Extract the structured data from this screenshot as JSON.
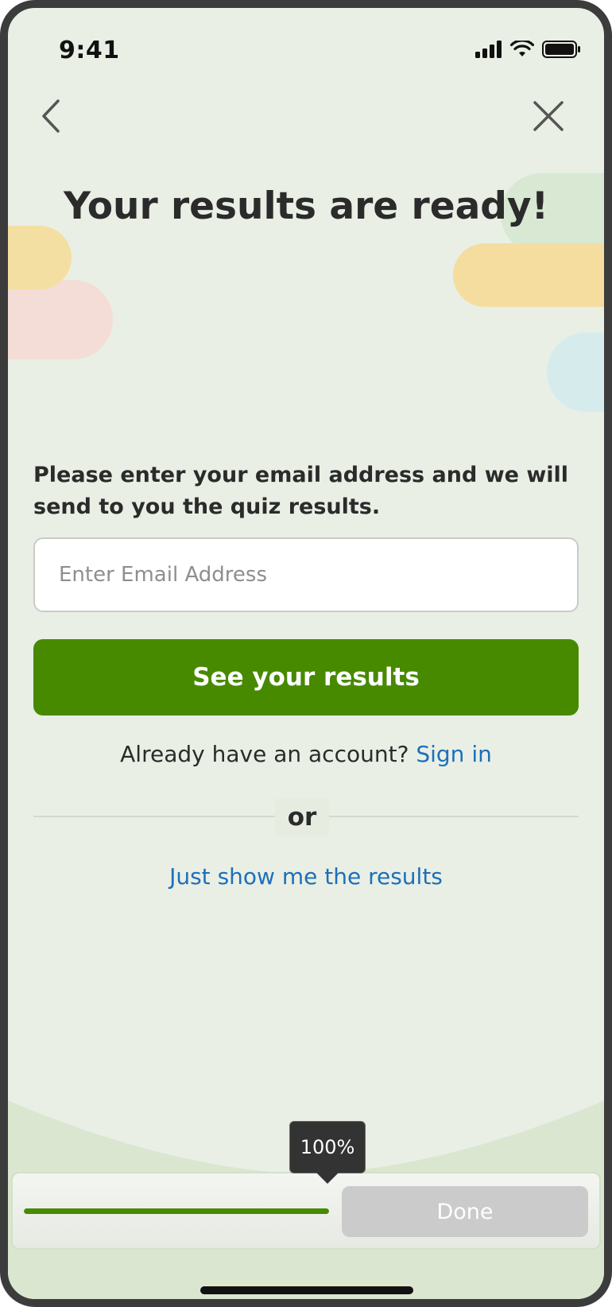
{
  "status_bar": {
    "time": "9:41",
    "icons": [
      "cellular-signal-icon",
      "wifi-icon",
      "battery-icon"
    ]
  },
  "nav": {
    "back_icon": "chevron-left-icon",
    "close_icon": "close-icon"
  },
  "header": {
    "title": "Your results are ready!"
  },
  "form": {
    "prompt": "Please enter your email address and we will send to you the quiz results.",
    "email_placeholder": "Enter Email Address",
    "email_value": "",
    "submit_label": "See your results"
  },
  "account": {
    "question": "Already have an account?",
    "sign_in_label": "Sign in"
  },
  "divider": {
    "label": "or"
  },
  "skip": {
    "label": "Just show me the results"
  },
  "footer": {
    "progress_percent": 100,
    "progress_label": "100%",
    "done_label": "Done"
  },
  "colors": {
    "background": "#e9efe5",
    "primary": "#478a00",
    "link": "#1e6fb9",
    "text": "#2b2b2b",
    "disabled_button": "#cbcbcb"
  }
}
